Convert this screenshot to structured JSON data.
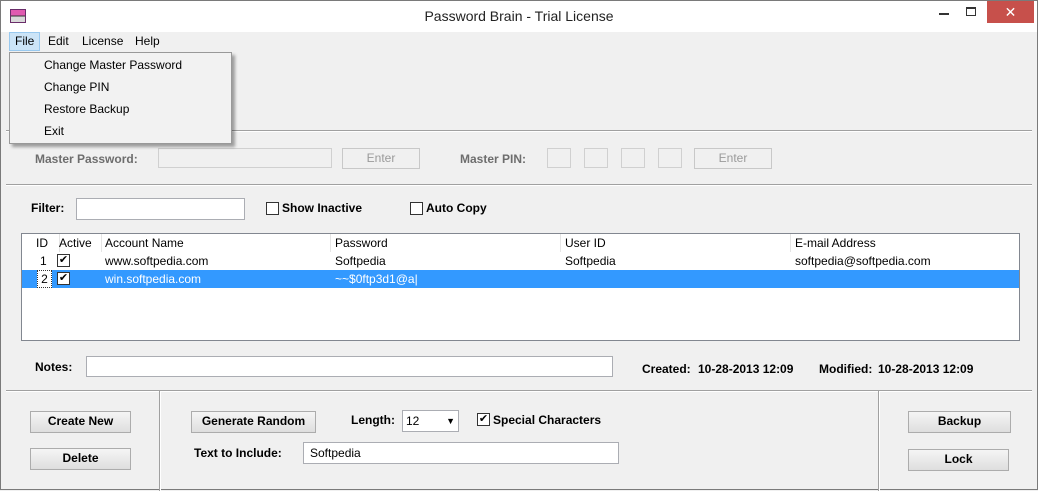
{
  "window": {
    "title": "Password Brain - Trial License",
    "close_glyph": "✕"
  },
  "menubar": {
    "file": "File",
    "edit": "Edit",
    "license": "License",
    "help": "Help"
  },
  "file_menu": {
    "items": [
      "Change Master Password",
      "Change PIN",
      "Restore Backup",
      "Exit"
    ]
  },
  "auth": {
    "master_password_label": "Master Password:",
    "enter_label": "Enter",
    "master_pin_label": "Master PIN:",
    "pin_enter_label": "Enter"
  },
  "filter": {
    "label": "Filter:",
    "value": "",
    "show_inactive_label": "Show Inactive",
    "show_inactive_checked": false,
    "auto_copy_label": "Auto Copy",
    "auto_copy_checked": false
  },
  "table": {
    "columns": [
      "ID",
      "Active",
      "Account Name",
      "Password",
      "User ID",
      "E-mail Address"
    ],
    "rows": [
      {
        "id": "1",
        "active": true,
        "account": "www.softpedia.com",
        "password": "Softpedia",
        "user_id": "Softpedia",
        "email": "softpedia@softpedia.com"
      },
      {
        "id": "2",
        "active": true,
        "account": "win.softpedia.com",
        "password": "~~$0ftp3d1@a|",
        "user_id": "",
        "email": "",
        "selected": true
      }
    ]
  },
  "notes": {
    "label": "Notes:",
    "value": "",
    "created_label": "Created:",
    "created_value": "10-28-2013 12:09",
    "modified_label": "Modified:",
    "modified_value": "10-28-2013 12:09"
  },
  "actions": {
    "create_new": "Create New",
    "delete": "Delete",
    "generate_random": "Generate Random",
    "length_label": "Length:",
    "length_value": "12",
    "special_chars_label": "Special Characters",
    "special_chars_checked": true,
    "text_include_label": "Text to Include:",
    "text_include_value": "Softpedia",
    "backup": "Backup",
    "lock": "Lock"
  },
  "check_glyph": "✔"
}
